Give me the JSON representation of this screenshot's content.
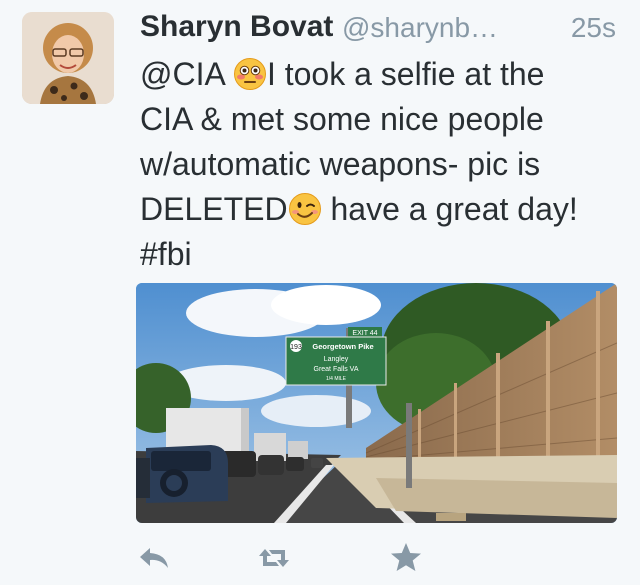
{
  "tweet": {
    "author_name": "Sharyn Bovat",
    "handle": "@sharynb…",
    "timestamp": "25s",
    "lines": [
      {
        "pre": "@CIA",
        "mid": "I took a selfie at the"
      },
      {
        "text": "CIA & met some nice people"
      },
      {
        "text": "w/automatic weapons- pic is"
      },
      {
        "pre": "DELETED",
        "post": " have a great day!"
      },
      {
        "text": "#fbi"
      }
    ],
    "emojis": [
      "flushed-face-icon",
      "winking-face-icon"
    ]
  },
  "photo": {
    "sign": {
      "exit": "EXIT 44",
      "route": "193",
      "title": "Georgetown Pike",
      "line1": "Langley",
      "line2": "Great Falls VA",
      "line3": "1/4 MILE"
    }
  },
  "actions": [
    "reply-icon",
    "retweet-icon",
    "favorite-icon"
  ],
  "colors": {
    "text": "#292f33",
    "muted": "#8899a6",
    "icon": "#8899a6",
    "background": "#f5f8fa",
    "sign": "#2f7a48"
  }
}
